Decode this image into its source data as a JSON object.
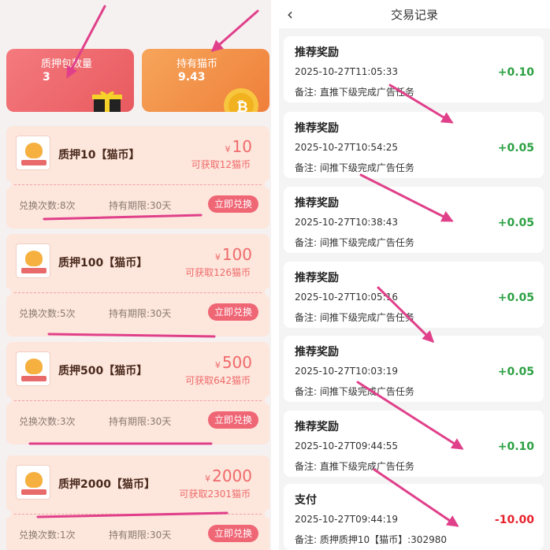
{
  "left": {
    "stats": [
      {
        "label": "质押包数量",
        "value": "3"
      },
      {
        "label": "持有猫币",
        "value": "9.43"
      }
    ],
    "coupons": [
      {
        "name": "质押10【猫币】",
        "yen": "¥",
        "price": "10",
        "get": "可获取12猫币",
        "times": "兑换次数:8次",
        "period": "持有期限:30天",
        "button": "立即兑换"
      },
      {
        "name": "质押100【猫币】",
        "yen": "¥",
        "price": "100",
        "get": "可获取126猫币",
        "times": "兑换次数:5次",
        "period": "持有期限:30天",
        "button": "立即兑换"
      },
      {
        "name": "质押500【猫币】",
        "yen": "¥",
        "price": "500",
        "get": "可获取642猫币",
        "times": "兑换次数:3次",
        "period": "持有期限:30天",
        "button": "立即兑换"
      },
      {
        "name": "质押2000【猫币】",
        "yen": "¥",
        "price": "2000",
        "get": "可获取2301猫币",
        "times": "兑换次数:1次",
        "period": "持有期限:30天",
        "button": "立即兑换"
      }
    ]
  },
  "right": {
    "header": {
      "back": "‹",
      "title": "交易记录"
    },
    "records": [
      {
        "type": "推荐奖励",
        "time": "2025-10-27T11:05:33",
        "note": "备注:  直推下级完成广告任务",
        "amount": "+0.10",
        "sign": "pos"
      },
      {
        "type": "推荐奖励",
        "time": "2025-10-27T10:54:25",
        "note": "备注:  间推下级完成广告任务",
        "amount": "+0.05",
        "sign": "pos"
      },
      {
        "type": "推荐奖励",
        "time": "2025-10-27T10:38:43",
        "note": "备注:  间推下级完成广告任务",
        "amount": "+0.05",
        "sign": "pos"
      },
      {
        "type": "推荐奖励",
        "time": "2025-10-27T10:05:16",
        "note": "备注:  间推下级完成广告任务",
        "amount": "+0.05",
        "sign": "pos"
      },
      {
        "type": "推荐奖励",
        "time": "2025-10-27T10:03:19",
        "note": "备注:  间推下级完成广告任务",
        "amount": "+0.05",
        "sign": "pos"
      },
      {
        "type": "推荐奖励",
        "time": "2025-10-27T09:44:55",
        "note": "备注:  直推下级完成广告任务",
        "amount": "+0.10",
        "sign": "pos"
      },
      {
        "type": "支付",
        "time": "2025-10-27T09:44:19",
        "note": "备注:  质押质押10【猫币】:302980",
        "amount": "-10.00",
        "sign": "neg"
      }
    ]
  },
  "colors": {
    "accent_red": "#ef6675",
    "positive": "#2ba042",
    "negative": "#e8222c",
    "annotation": "#e0408a"
  }
}
